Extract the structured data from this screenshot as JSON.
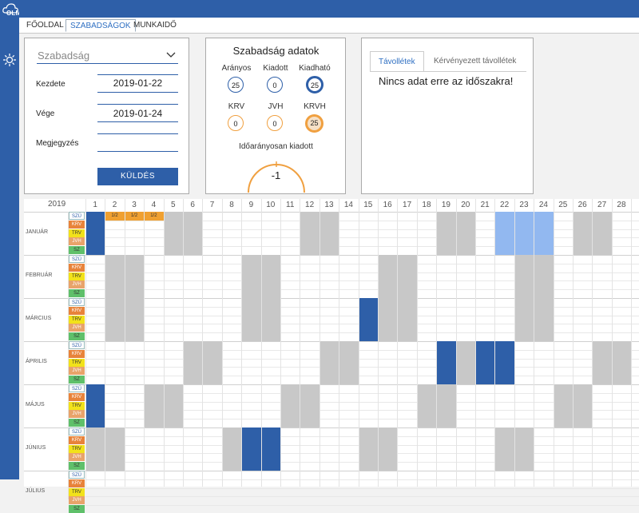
{
  "app": {
    "logo_text": "OLM"
  },
  "tabs": [
    {
      "label": "FŐOLDAL",
      "active": false
    },
    {
      "label": "SZABADSÁGOK",
      "active": true
    },
    {
      "label": "MUNKAIDŐ",
      "active": false
    }
  ],
  "form": {
    "type_value": "Szabadság",
    "start_label": "Kezdete",
    "start_value": "2019-01-22",
    "end_label": "Vége",
    "end_value": "2019-01-24",
    "note_label": "Megjegyzés",
    "note_value": "",
    "submit_label": "KÜLDÉS"
  },
  "stats": {
    "title": "Szabadság adatok",
    "items": [
      {
        "label": "Arányos",
        "value": "25",
        "color": "#2e5fa8"
      },
      {
        "label": "Kiadott",
        "value": "0",
        "color": "#2e5fa8"
      },
      {
        "label": "Kiadható",
        "value": "25",
        "color": "#2e5fa8"
      },
      {
        "label": "KRV",
        "value": "0",
        "color": "#f0a040"
      },
      {
        "label": "JVH",
        "value": "0",
        "color": "#f0a040"
      },
      {
        "label": "KRVH",
        "value": "25",
        "color": "#f0a040"
      }
    ],
    "proportional_label": "Időarányosan kiadott",
    "proportional_value": "-1"
  },
  "absences": {
    "tabs": [
      {
        "label": "Távollétek",
        "active": true
      },
      {
        "label": "Kérvényezett távollétek",
        "active": false
      }
    ],
    "empty_text": "Nincs adat erre az időszakra!"
  },
  "calendar": {
    "year": "2019",
    "days": [
      "1",
      "2",
      "3",
      "4",
      "5",
      "6",
      "7",
      "8",
      "9",
      "10",
      "11",
      "12",
      "13",
      "14",
      "15",
      "16",
      "17",
      "18",
      "19",
      "20",
      "21",
      "22",
      "23",
      "24",
      "25",
      "26",
      "27",
      "28"
    ],
    "types": [
      {
        "code": "SZÜ",
        "bg": "#ffffff",
        "fg": "#2e5fa8"
      },
      {
        "code": "KRV",
        "bg": "#e8833a",
        "fg": "#ffffff"
      },
      {
        "code": "TRV",
        "bg": "#f2e21a",
        "fg": "#333333"
      },
      {
        "code": "JVH",
        "bg": "#e8a36a",
        "fg": "#ffffff"
      },
      {
        "code": "SZ",
        "bg": "#5fc06a",
        "fg": "#333333"
      }
    ],
    "months": [
      {
        "name": "JANUÁR",
        "weekend_days": [
          5,
          6,
          12,
          13,
          19,
          20,
          26,
          27
        ],
        "holiday_days": [
          1
        ],
        "half_days": [
          2,
          3,
          4
        ],
        "half_label": "1/2",
        "selected_days": [
          22,
          23,
          24
        ]
      },
      {
        "name": "FEBRUÁR",
        "weekend_days": [
          2,
          3,
          9,
          10,
          16,
          17,
          23,
          24
        ],
        "holiday_days": []
      },
      {
        "name": "MÁRCIUS",
        "weekend_days": [
          2,
          3,
          9,
          10,
          16,
          17,
          23,
          24
        ],
        "holiday_days": [
          15
        ]
      },
      {
        "name": "ÁPRILIS",
        "weekend_days": [
          6,
          7,
          13,
          14,
          20,
          21,
          27,
          28
        ],
        "holiday_days": [
          19,
          21,
          22
        ]
      },
      {
        "name": "MÁJUS",
        "weekend_days": [
          4,
          5,
          11,
          12,
          18,
          19,
          25,
          26
        ],
        "holiday_days": [
          1
        ]
      },
      {
        "name": "JÚNIUS",
        "weekend_days": [
          1,
          2,
          8,
          15,
          16,
          22,
          23
        ],
        "holiday_days": [
          9,
          10
        ]
      },
      {
        "name": "JÚLIUS",
        "weekend_days": []
      }
    ],
    "colors": {
      "weekend": "#c8c8c8",
      "holiday": "#2e5fa8",
      "half": "#f0a030",
      "selected": "#92b8f0"
    }
  }
}
